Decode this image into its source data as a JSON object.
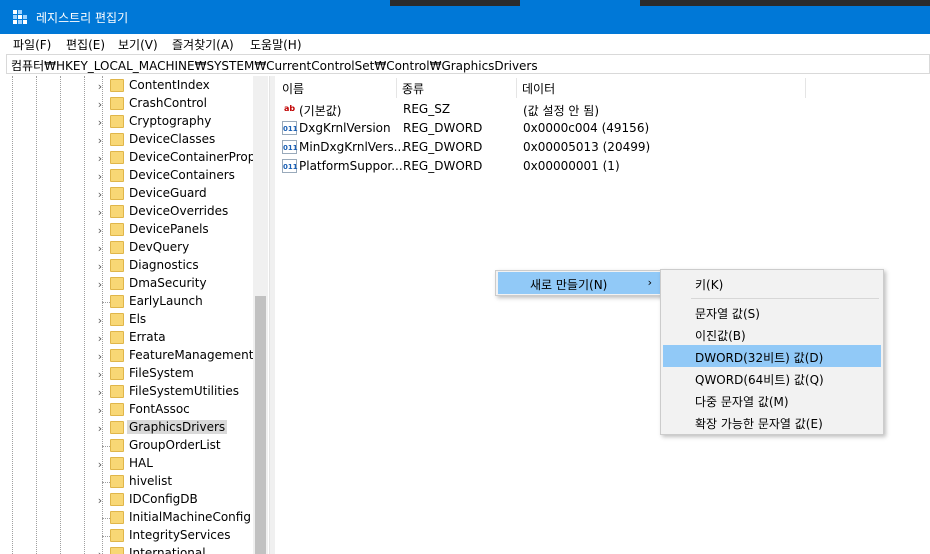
{
  "window": {
    "title": "레지스트리 편집기",
    "accent": "#0078d7"
  },
  "menubar": {
    "items": [
      "파일(F)",
      "편집(E)",
      "보기(V)",
      "즐겨찾기(A)",
      "도움말(H)"
    ]
  },
  "address": {
    "path": "컴퓨터₩HKEY_LOCAL_MACHINE₩SYSTEM₩CurrentControlSet₩Control₩GraphicsDrivers"
  },
  "tree": {
    "selected": "GraphicsDrivers",
    "items": [
      {
        "label": "ContentIndex",
        "expandable": true
      },
      {
        "label": "CrashControl",
        "expandable": true
      },
      {
        "label": "Cryptography",
        "expandable": true
      },
      {
        "label": "DeviceClasses",
        "expandable": true
      },
      {
        "label": "DeviceContainerProper",
        "expandable": true
      },
      {
        "label": "DeviceContainers",
        "expandable": true
      },
      {
        "label": "DeviceGuard",
        "expandable": true
      },
      {
        "label": "DeviceOverrides",
        "expandable": true
      },
      {
        "label": "DevicePanels",
        "expandable": true
      },
      {
        "label": "DevQuery",
        "expandable": true
      },
      {
        "label": "Diagnostics",
        "expandable": true
      },
      {
        "label": "DmaSecurity",
        "expandable": true
      },
      {
        "label": "EarlyLaunch",
        "expandable": false
      },
      {
        "label": "Els",
        "expandable": true
      },
      {
        "label": "Errata",
        "expandable": true
      },
      {
        "label": "FeatureManagement",
        "expandable": true
      },
      {
        "label": "FileSystem",
        "expandable": true
      },
      {
        "label": "FileSystemUtilities",
        "expandable": true
      },
      {
        "label": "FontAssoc",
        "expandable": true
      },
      {
        "label": "GraphicsDrivers",
        "expandable": true
      },
      {
        "label": "GroupOrderList",
        "expandable": false
      },
      {
        "label": "HAL",
        "expandable": true
      },
      {
        "label": "hivelist",
        "expandable": false
      },
      {
        "label": "IDConfigDB",
        "expandable": true
      },
      {
        "label": "InitialMachineConfig",
        "expandable": false
      },
      {
        "label": "IntegrityServices",
        "expandable": false
      },
      {
        "label": "International",
        "expandable": true
      }
    ]
  },
  "values": {
    "columns": [
      "이름",
      "종류",
      "데이터"
    ],
    "rows": [
      {
        "icon": "string-value-icon",
        "name": "(기본값)",
        "type": "REG_SZ",
        "data": "(값 설정 안 됨)"
      },
      {
        "icon": "binary-value-icon",
        "name": "DxgKrnlVersion",
        "type": "REG_DWORD",
        "data": "0x0000c004 (49156)"
      },
      {
        "icon": "binary-value-icon",
        "name": "MinDxgKrnlVers...",
        "type": "REG_DWORD",
        "data": "0x00005013 (20499)"
      },
      {
        "icon": "binary-value-icon",
        "name": "PlatformSuppor...",
        "type": "REG_DWORD",
        "data": "0x00000001 (1)"
      }
    ]
  },
  "context_menu": {
    "new_label": "새로 만들기(N)",
    "submenu": {
      "key": "키(K)",
      "items": [
        "문자열 값(S)",
        "이진값(B)",
        "DWORD(32비트) 값(D)",
        "QWORD(64비트) 값(Q)",
        "다중 문자열 값(M)",
        "확장 가능한 문자열 값(E)"
      ],
      "highlighted": "DWORD(32비트) 값(D)"
    },
    "highlight_color": "#91c9f7"
  }
}
